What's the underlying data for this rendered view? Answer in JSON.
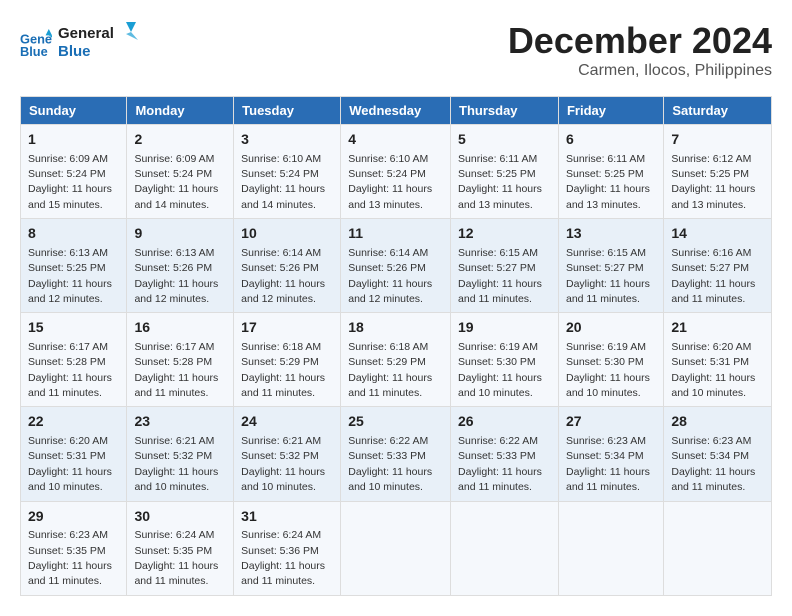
{
  "logo": {
    "line1": "General",
    "line2": "Blue"
  },
  "title": "December 2024",
  "location": "Carmen, Ilocos, Philippines",
  "weekdays": [
    "Sunday",
    "Monday",
    "Tuesday",
    "Wednesday",
    "Thursday",
    "Friday",
    "Saturday"
  ],
  "weeks": [
    [
      {
        "day": 1,
        "sunrise": "6:09 AM",
        "sunset": "5:24 PM",
        "daylight": "11 hours and 15 minutes."
      },
      {
        "day": 2,
        "sunrise": "6:09 AM",
        "sunset": "5:24 PM",
        "daylight": "11 hours and 14 minutes."
      },
      {
        "day": 3,
        "sunrise": "6:10 AM",
        "sunset": "5:24 PM",
        "daylight": "11 hours and 14 minutes."
      },
      {
        "day": 4,
        "sunrise": "6:10 AM",
        "sunset": "5:24 PM",
        "daylight": "11 hours and 13 minutes."
      },
      {
        "day": 5,
        "sunrise": "6:11 AM",
        "sunset": "5:25 PM",
        "daylight": "11 hours and 13 minutes."
      },
      {
        "day": 6,
        "sunrise": "6:11 AM",
        "sunset": "5:25 PM",
        "daylight": "11 hours and 13 minutes."
      },
      {
        "day": 7,
        "sunrise": "6:12 AM",
        "sunset": "5:25 PM",
        "daylight": "11 hours and 13 minutes."
      }
    ],
    [
      {
        "day": 8,
        "sunrise": "6:13 AM",
        "sunset": "5:25 PM",
        "daylight": "11 hours and 12 minutes."
      },
      {
        "day": 9,
        "sunrise": "6:13 AM",
        "sunset": "5:26 PM",
        "daylight": "11 hours and 12 minutes."
      },
      {
        "day": 10,
        "sunrise": "6:14 AM",
        "sunset": "5:26 PM",
        "daylight": "11 hours and 12 minutes."
      },
      {
        "day": 11,
        "sunrise": "6:14 AM",
        "sunset": "5:26 PM",
        "daylight": "11 hours and 12 minutes."
      },
      {
        "day": 12,
        "sunrise": "6:15 AM",
        "sunset": "5:27 PM",
        "daylight": "11 hours and 11 minutes."
      },
      {
        "day": 13,
        "sunrise": "6:15 AM",
        "sunset": "5:27 PM",
        "daylight": "11 hours and 11 minutes."
      },
      {
        "day": 14,
        "sunrise": "6:16 AM",
        "sunset": "5:27 PM",
        "daylight": "11 hours and 11 minutes."
      }
    ],
    [
      {
        "day": 15,
        "sunrise": "6:17 AM",
        "sunset": "5:28 PM",
        "daylight": "11 hours and 11 minutes."
      },
      {
        "day": 16,
        "sunrise": "6:17 AM",
        "sunset": "5:28 PM",
        "daylight": "11 hours and 11 minutes."
      },
      {
        "day": 17,
        "sunrise": "6:18 AM",
        "sunset": "5:29 PM",
        "daylight": "11 hours and 11 minutes."
      },
      {
        "day": 18,
        "sunrise": "6:18 AM",
        "sunset": "5:29 PM",
        "daylight": "11 hours and 11 minutes."
      },
      {
        "day": 19,
        "sunrise": "6:19 AM",
        "sunset": "5:30 PM",
        "daylight": "11 hours and 10 minutes."
      },
      {
        "day": 20,
        "sunrise": "6:19 AM",
        "sunset": "5:30 PM",
        "daylight": "11 hours and 10 minutes."
      },
      {
        "day": 21,
        "sunrise": "6:20 AM",
        "sunset": "5:31 PM",
        "daylight": "11 hours and 10 minutes."
      }
    ],
    [
      {
        "day": 22,
        "sunrise": "6:20 AM",
        "sunset": "5:31 PM",
        "daylight": "11 hours and 10 minutes."
      },
      {
        "day": 23,
        "sunrise": "6:21 AM",
        "sunset": "5:32 PM",
        "daylight": "11 hours and 10 minutes."
      },
      {
        "day": 24,
        "sunrise": "6:21 AM",
        "sunset": "5:32 PM",
        "daylight": "11 hours and 10 minutes."
      },
      {
        "day": 25,
        "sunrise": "6:22 AM",
        "sunset": "5:33 PM",
        "daylight": "11 hours and 10 minutes."
      },
      {
        "day": 26,
        "sunrise": "6:22 AM",
        "sunset": "5:33 PM",
        "daylight": "11 hours and 11 minutes."
      },
      {
        "day": 27,
        "sunrise": "6:23 AM",
        "sunset": "5:34 PM",
        "daylight": "11 hours and 11 minutes."
      },
      {
        "day": 28,
        "sunrise": "6:23 AM",
        "sunset": "5:34 PM",
        "daylight": "11 hours and 11 minutes."
      }
    ],
    [
      {
        "day": 29,
        "sunrise": "6:23 AM",
        "sunset": "5:35 PM",
        "daylight": "11 hours and 11 minutes."
      },
      {
        "day": 30,
        "sunrise": "6:24 AM",
        "sunset": "5:35 PM",
        "daylight": "11 hours and 11 minutes."
      },
      {
        "day": 31,
        "sunrise": "6:24 AM",
        "sunset": "5:36 PM",
        "daylight": "11 hours and 11 minutes."
      },
      null,
      null,
      null,
      null
    ]
  ]
}
